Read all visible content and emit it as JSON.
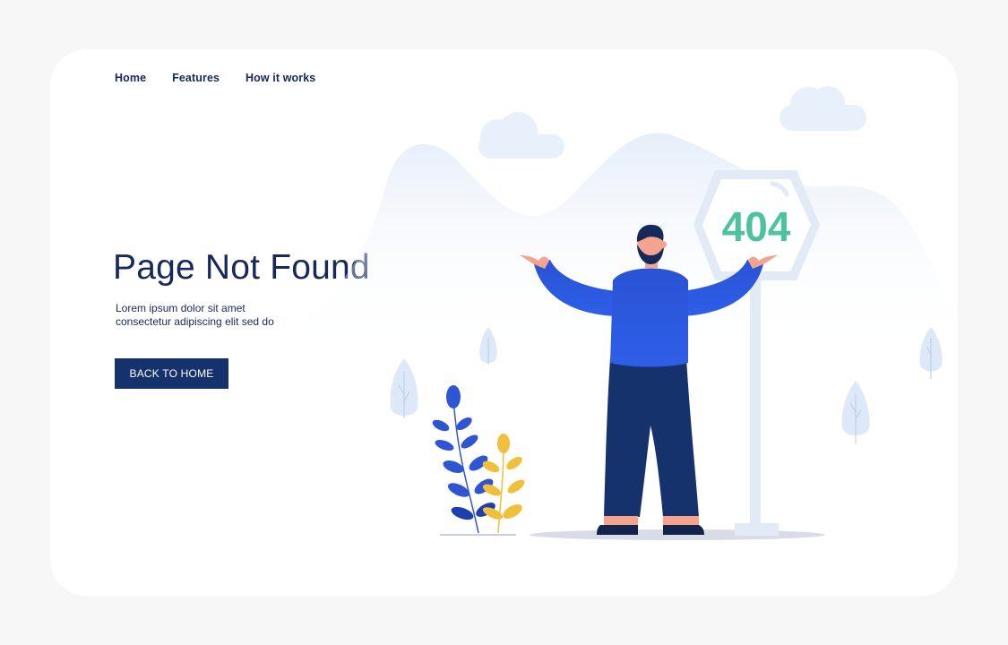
{
  "nav": {
    "items": [
      {
        "label": "Home"
      },
      {
        "label": "Features"
      },
      {
        "label": "How it works"
      }
    ]
  },
  "hero": {
    "title": "Page Not Found",
    "subtitle": "Lorem ipsum dolor sit amet consectetur adipiscing elit sed do",
    "cta_label": "BACK TO HOME"
  },
  "illustration": {
    "sign_text": "404",
    "sign_color": "#4cc39a",
    "shirt_color": "#2b55d9",
    "pants_color": "#16326d",
    "background_blob_color": "#e9f1fb",
    "icons": [
      "cloud-icon",
      "signpost-icon",
      "person-icon",
      "plant-icon",
      "tree-icon"
    ]
  },
  "colors": {
    "primary": "#16326d",
    "text": "#16295a",
    "page_background": "#f7f7f7",
    "card_background": "#ffffff"
  }
}
